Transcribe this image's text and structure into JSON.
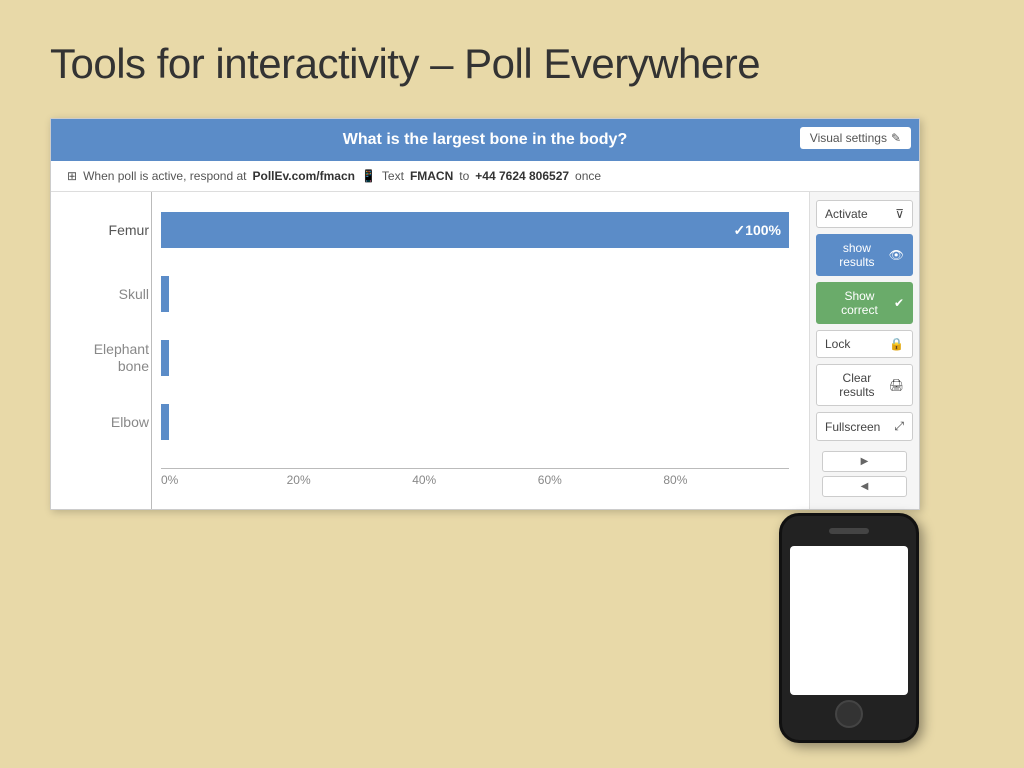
{
  "slide": {
    "title": "Tools for interactivity – Poll Everywhere",
    "background_color": "#e8d9a8"
  },
  "poll": {
    "question": "What is the largest bone in the body?",
    "subheader": {
      "prefix": "When poll is active, respond at",
      "url": "PollEv.com/fmacn",
      "text_label": "Text",
      "text_code": "FMACN",
      "text_to": "to",
      "phone_number": "+44 7624 806527",
      "suffix": "once"
    },
    "visual_settings_label": "Visual settings",
    "answers": [
      {
        "label": "Femur",
        "percentage": 100,
        "correct": true
      },
      {
        "label": "Skull",
        "percentage": 0,
        "correct": false
      },
      {
        "label": "Elephant bone",
        "percentage": 0,
        "correct": false
      },
      {
        "label": "Elbow",
        "percentage": 0,
        "correct": false
      }
    ],
    "x_axis_labels": [
      "0%",
      "20%",
      "40%",
      "60%",
      "80%"
    ],
    "sidebar": {
      "activate_label": "Activate",
      "show_results_label": "show results",
      "show_correct_label": "Show correct",
      "lock_label": "Lock",
      "clear_results_label": "Clear results",
      "fullscreen_label": "Fullscreen"
    }
  }
}
